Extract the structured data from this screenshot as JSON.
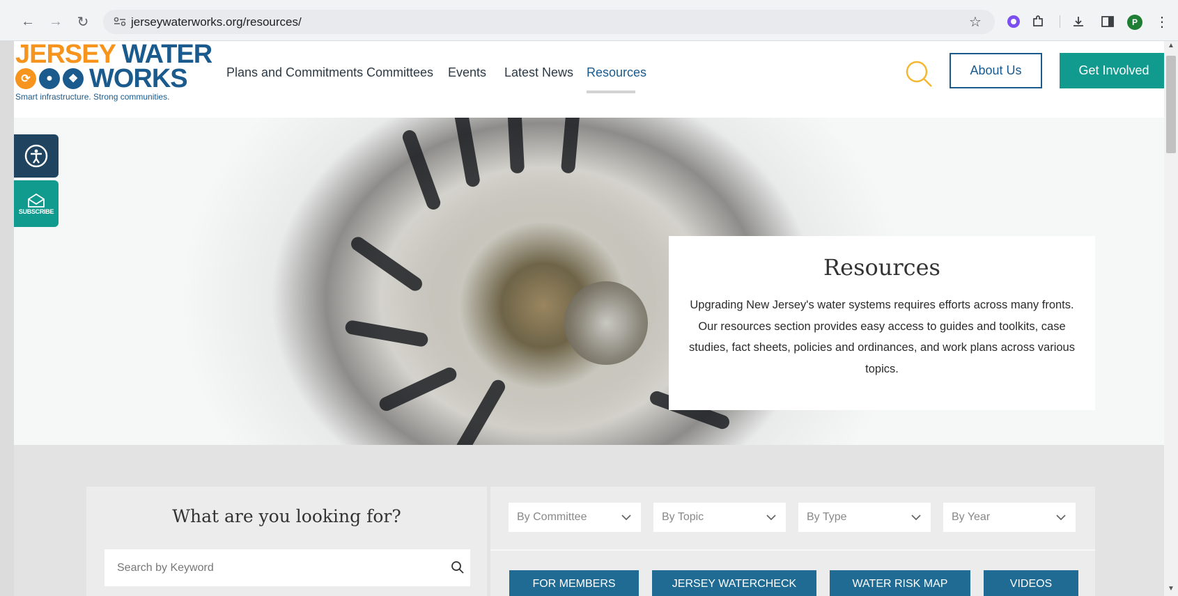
{
  "browser": {
    "url": "jerseywaterworks.org/resources/",
    "profile_initial": "P"
  },
  "logo": {
    "word1": "JERSEY",
    "word2": "WATER",
    "word3": "WORKS",
    "tagline": "Smart infrastructure. Strong communities."
  },
  "nav": {
    "items": [
      "Plans and Commitments",
      "Committees",
      "Events",
      "Latest News",
      "Resources"
    ],
    "active": "Resources",
    "about_label": "About Us",
    "get_involved_label": "Get Involved"
  },
  "widgets": {
    "subscribe_label": "SUBSCRIBE"
  },
  "hero": {
    "title": "Resources",
    "description": "Upgrading New Jersey's water systems requires efforts across many fronts. Our resources section provides easy access to guides and toolkits, case studies, fact sheets, policies and ordinances, and work plans across various topics."
  },
  "search": {
    "heading": "What are you looking for?",
    "placeholder": "Search by Keyword"
  },
  "filters": {
    "committee": "By Committee",
    "topic": "By Topic",
    "type": "By Type",
    "year": "By Year"
  },
  "quick_links": [
    "FOR MEMBERS",
    "JERSEY WATERCHECK",
    "WATER RISK MAP",
    "VIDEOS"
  ],
  "colors": {
    "brand_blue": "#1a5a8c",
    "brand_orange": "#f7941d",
    "teal": "#109b8e",
    "button_blue": "#1f6b94"
  }
}
